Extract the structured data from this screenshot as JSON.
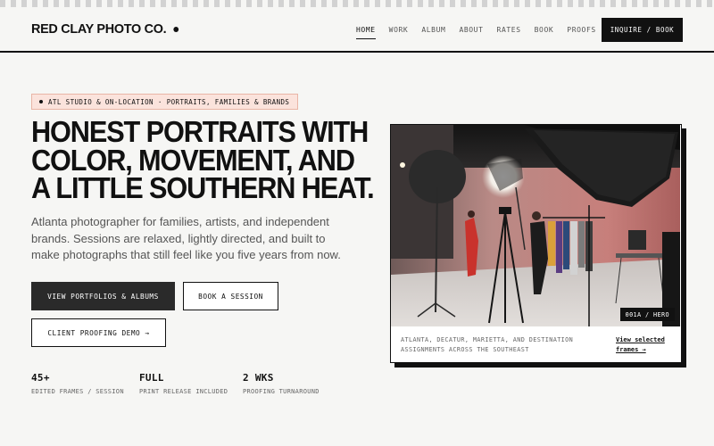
{
  "brand": {
    "name": "RED CLAY PHOTO CO."
  },
  "nav": {
    "items": [
      {
        "label": "HOME",
        "active": true
      },
      {
        "label": "WORK",
        "active": false
      },
      {
        "label": "ALBUM",
        "active": false
      },
      {
        "label": "ABOUT",
        "active": false
      },
      {
        "label": "RATES",
        "active": false
      },
      {
        "label": "BOOK",
        "active": false
      },
      {
        "label": "PROOFS",
        "active": false
      }
    ],
    "cta_label": "INQUIRE / BOOK"
  },
  "hero": {
    "badge": "ATL STUDIO & ON-LOCATION · PORTRAITS, FAMILIES & BRANDS",
    "headline": [
      "HONEST PORTRAITS WITH",
      "COLOR, MOVEMENT, AND",
      "A LITTLE SOUTHERN HEAT."
    ],
    "lede": "Atlanta photographer for families, artists, and independent brands. Sessions are relaxed, lightly directed, and built to make photographs that still feel like you five years from now.",
    "buttons": {
      "portfolio": "VIEW PORTFOLIOS & ALBUMS",
      "book": "BOOK A SESSION",
      "proofing": "CLIENT PROOFING DEMO →"
    }
  },
  "stats": [
    {
      "value": "45+",
      "label": "EDITED FRAMES / SESSION"
    },
    {
      "value": "FULL",
      "label": "PRINT RELEASE INCLUDED"
    },
    {
      "value": "2 WKS",
      "label": "PROOFING TURNAROUND"
    }
  ],
  "hero_card": {
    "tag": "001A / HERO",
    "caption": "ATLANTA, DECATUR, MARIETTA, AND DESTINATION ASSIGNMENTS ACROSS THE SOUTHEAST",
    "link": "View selected frames →"
  },
  "colors": {
    "background": "#f6f6f4",
    "ink": "#111111",
    "accent_soft": "#fbe3dc",
    "backdrop_pink": "#c98580"
  }
}
